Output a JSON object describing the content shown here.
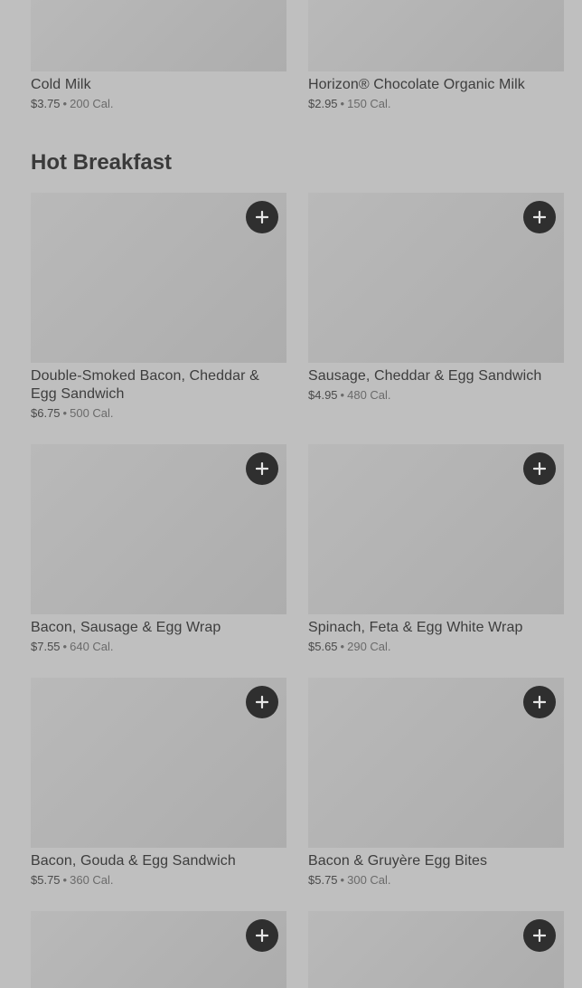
{
  "top_items": [
    {
      "name": "Cold Milk",
      "price": "$3.75",
      "calories": "200 Cal."
    },
    {
      "name": "Horizon® Chocolate Organic Milk",
      "price": "$2.95",
      "calories": "150 Cal."
    }
  ],
  "section": {
    "title": "Hot Breakfast"
  },
  "items": [
    {
      "name": "Double-Smoked Bacon, Cheddar & Egg Sandwich",
      "price": "$6.75",
      "calories": "500 Cal."
    },
    {
      "name": "Sausage, Cheddar & Egg Sandwich",
      "price": "$4.95",
      "calories": "480 Cal."
    },
    {
      "name": "Bacon, Sausage & Egg Wrap",
      "price": "$7.55",
      "calories": "640 Cal."
    },
    {
      "name": "Spinach, Feta & Egg White Wrap",
      "price": "$5.65",
      "calories": "290 Cal."
    },
    {
      "name": "Bacon, Gouda & Egg Sandwich",
      "price": "$5.75",
      "calories": "360 Cal."
    },
    {
      "name": "Bacon & Gruyère Egg Bites",
      "price": "$5.75",
      "calories": "300 Cal."
    }
  ],
  "separator": "•",
  "icons": {
    "add": "plus-icon"
  },
  "colors": {
    "background": "#bfbfbf",
    "add_button": "#2f2f2f",
    "title": "#3a3a3a"
  }
}
